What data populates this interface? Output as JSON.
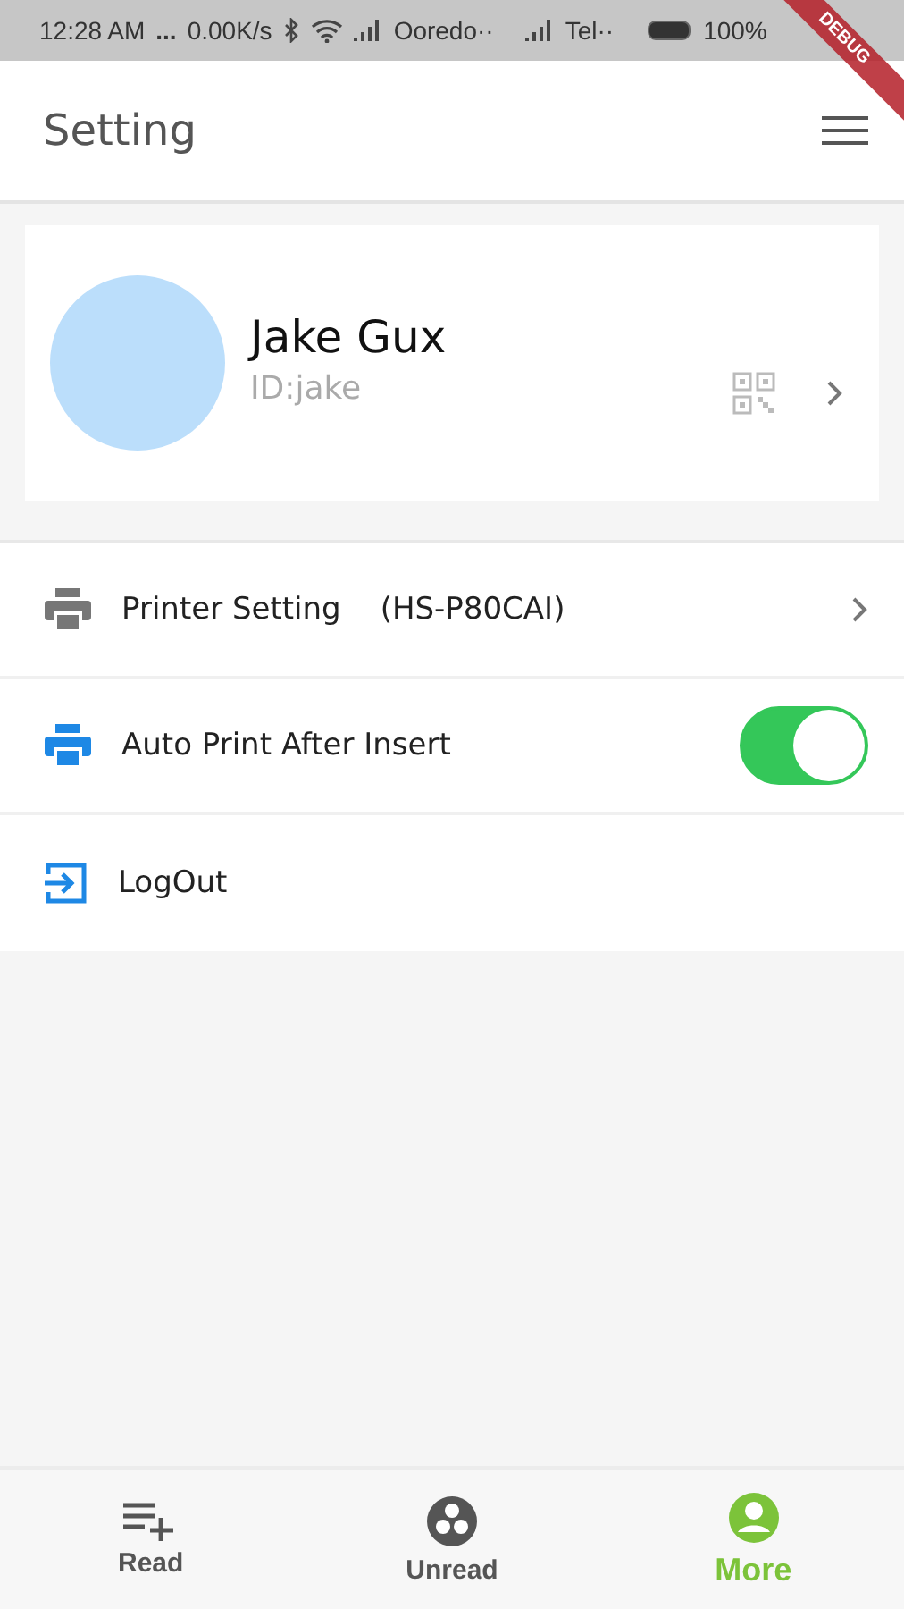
{
  "status_bar": {
    "time": "12:28 AM",
    "dots": "...",
    "speed": "0.00K/s",
    "carrier_1": "Ooredo··",
    "carrier_2": "Tel··",
    "battery": "100%"
  },
  "debug_banner": "DEBUG",
  "app_bar": {
    "title": "Setting"
  },
  "profile": {
    "name": "Jake Gux",
    "id": "ID:jake"
  },
  "menu": [
    {
      "kind": "link",
      "label": "Printer Setting",
      "detail": "(HS-P80CAI)"
    },
    {
      "kind": "toggle",
      "label": "Auto Print After Insert",
      "on": true
    },
    {
      "kind": "action",
      "label": "LogOut"
    }
  ],
  "tabs": [
    {
      "label": "Read",
      "selected": false
    },
    {
      "label": "Unread",
      "selected": false
    },
    {
      "label": "More",
      "selected": true
    }
  ]
}
